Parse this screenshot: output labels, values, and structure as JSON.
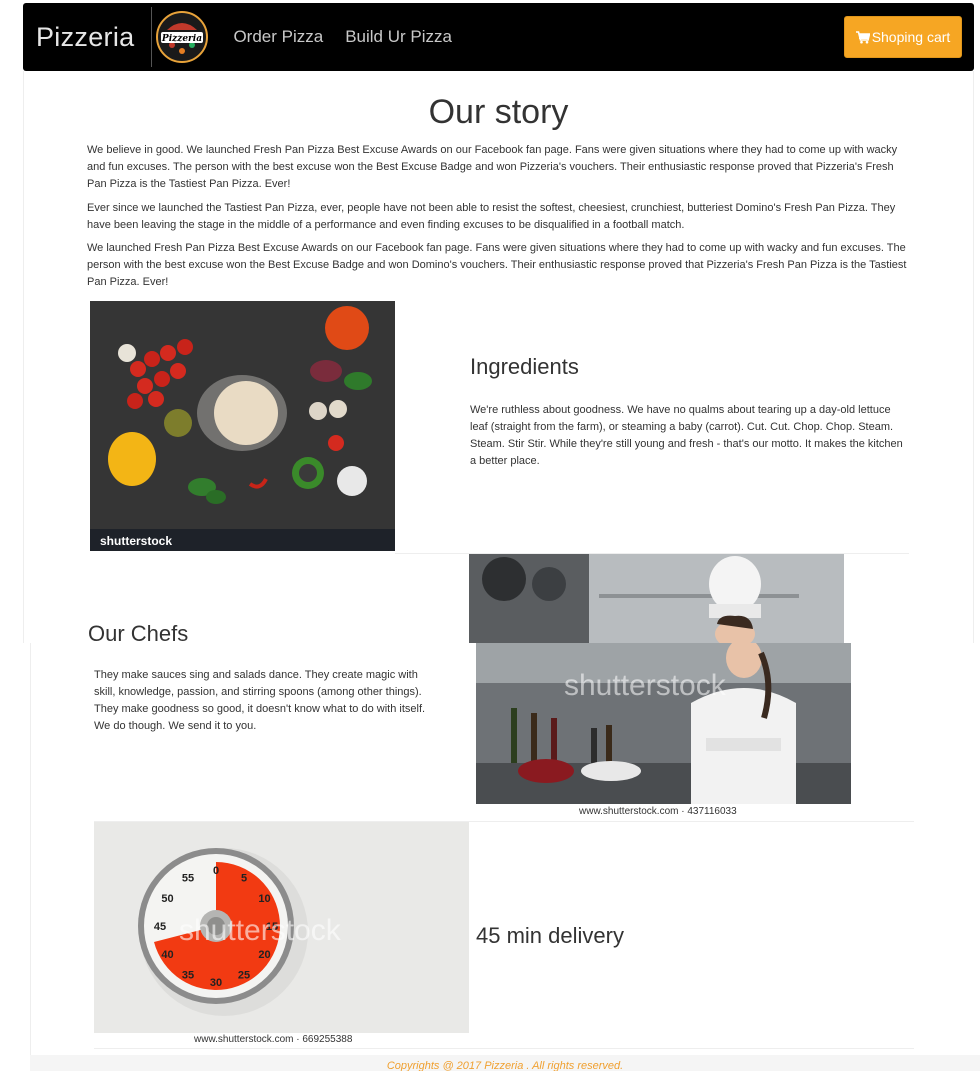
{
  "navbar": {
    "brand": "Pizzeria",
    "logo_text": "Pizzeria",
    "links": [
      "Order Pizza",
      "Build Ur Pizza"
    ],
    "cart_label": "Shoping cart"
  },
  "story": {
    "title": "Our story",
    "paragraphs": [
      "We believe in good. We launched Fresh Pan Pizza Best Excuse Awards on our Facebook fan page. Fans were given situations where they had to come up with wacky and fun excuses. The person with the best excuse won the Best Excuse Badge and won Pizzeria's vouchers. Their enthusiastic response proved that Pizzeria's Fresh Pan Pizza is the Tastiest Pan Pizza. Ever!",
      "Ever since we launched the Tastiest Pan Pizza, ever, people have not been able to resist the softest, cheesiest, crunchiest, butteriest Domino's Fresh Pan Pizza. They have been leaving the stage in the middle of a performance and even finding excuses to be disqualified in a football match.",
      "We launched Fresh Pan Pizza Best Excuse Awards on our Facebook fan page. Fans were given situations where they had to come up with wacky and fun excuses. The person with the best excuse won the Best Excuse Badge and won Domino's vouchers. Their enthusiastic response proved that Pizzeria's Fresh Pan Pizza is the Tastiest Pan Pizza. Ever!"
    ]
  },
  "ingredients": {
    "title": "Ingredients",
    "text": "We're ruthless about goodness. We have no qualms about tearing up a day-old lettuce leaf (straight from the farm), or steaming a baby (carrot). Cut. Cut. Chop. Chop. Steam. Steam. Stir Stir. While they're still young and fresh - that's our motto. It makes the kitchen a better place.",
    "watermark": "shutterstock"
  },
  "chefs": {
    "title": "Our Chefs",
    "text": "They make sauces sing and salads dance. They create magic with skill, knowledge, passion, and stirring spoons (among other things). They make goodness so good, it doesn't know what to do with itself. We do though. We send it to you.",
    "watermark": "shutterstock",
    "caption": "www.shutterstock.com · 437116033"
  },
  "delivery": {
    "title": "45 min delivery",
    "watermark": "shutterstock",
    "caption": "www.shutterstock.com · 669255388",
    "timer_numbers": [
      "0",
      "5",
      "10",
      "15",
      "20",
      "25",
      "30",
      "35",
      "40",
      "45",
      "50",
      "55"
    ]
  },
  "footer": {
    "text": "Copyrights @ 2017 Pizzeria . All rights reserved."
  },
  "colors": {
    "navbar_bg": "#000000",
    "cart_button": "#f6a623",
    "footer_text": "#f0a030"
  }
}
